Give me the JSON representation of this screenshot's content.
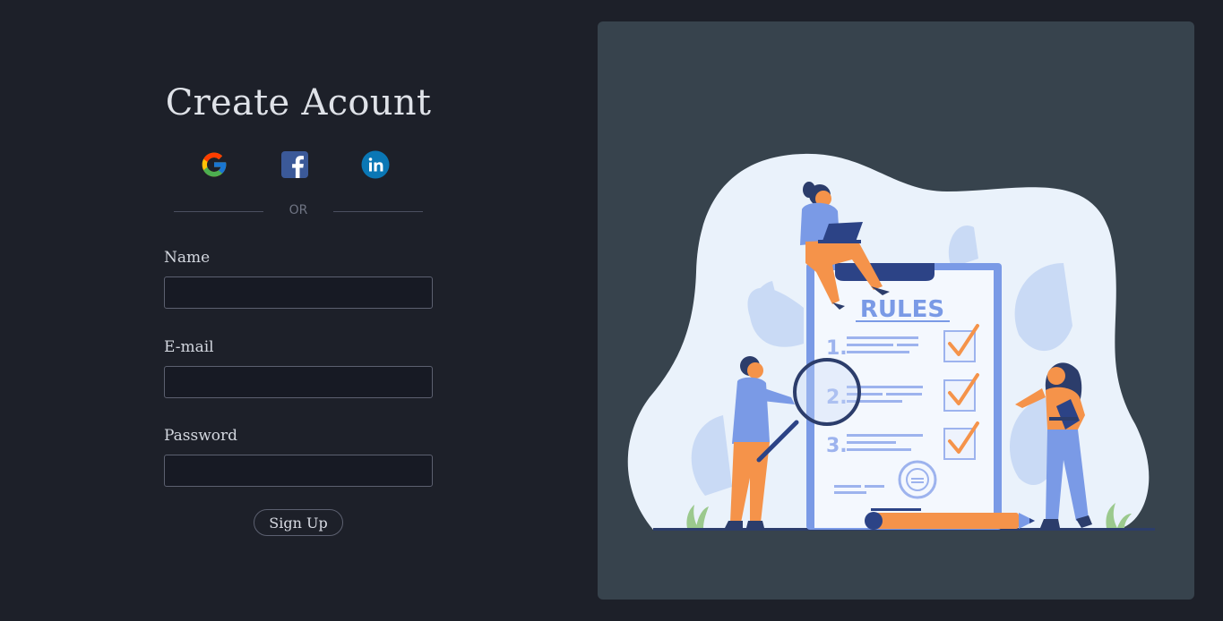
{
  "form": {
    "title": "Create Acount",
    "social": [
      {
        "name": "google-icon"
      },
      {
        "name": "facebook-icon"
      },
      {
        "name": "linkedin-icon"
      }
    ],
    "divider_text": "OR",
    "fields": {
      "name": {
        "label": "Name",
        "value": "",
        "placeholder": ""
      },
      "email": {
        "label": "E-mail",
        "value": "",
        "placeholder": ""
      },
      "password": {
        "label": "Password",
        "value": "",
        "placeholder": ""
      }
    },
    "submit_label": "Sign Up"
  },
  "illustration": {
    "heading": "RULES",
    "items": [
      "1.",
      "2.",
      "3."
    ]
  },
  "colors": {
    "background": "#1d2029",
    "panel": "#37434d",
    "input_background": "#171a24",
    "border": "#5c6070",
    "accent_orange": "#f5934a",
    "accent_blue": "#6f8fe0"
  }
}
